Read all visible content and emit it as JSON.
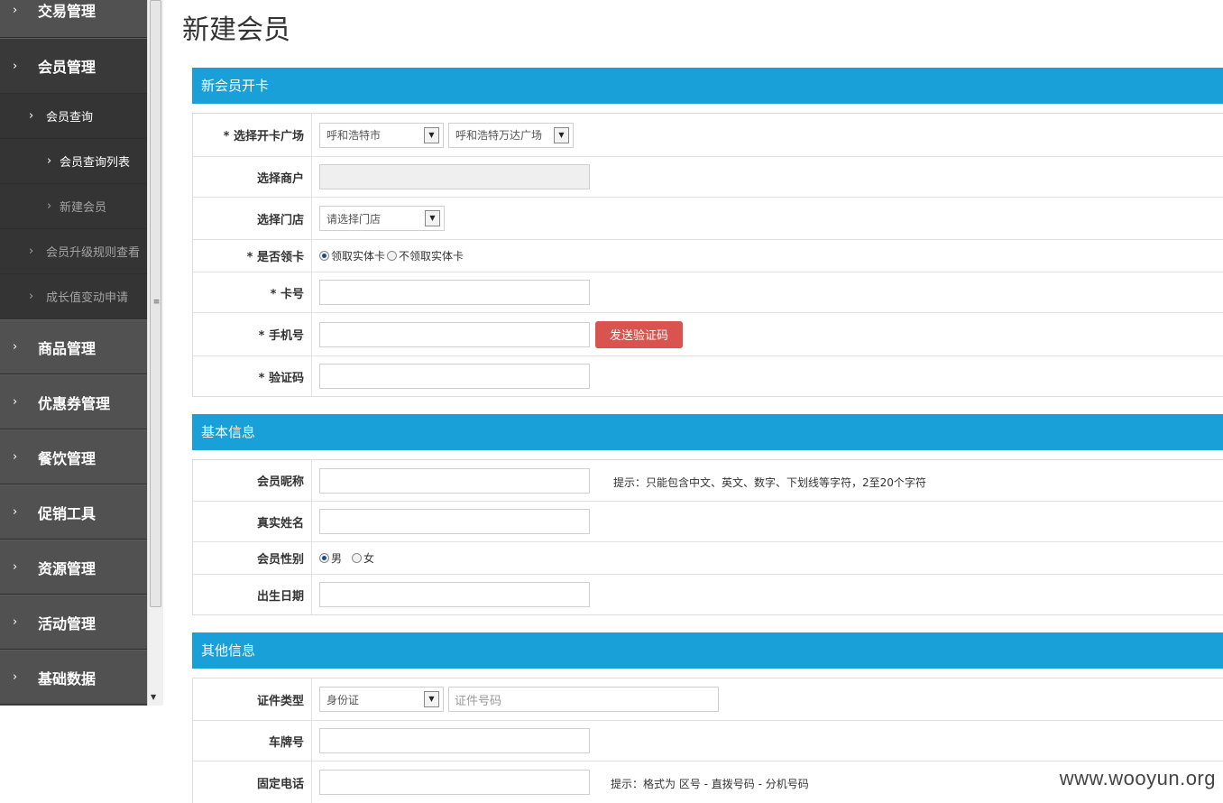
{
  "page_title": "新建会员",
  "sidebar": {
    "items": [
      {
        "label": "交易管理",
        "level": "top"
      },
      {
        "label": "会员管理",
        "level": "top",
        "active": true
      },
      {
        "label": "会员查询",
        "level": "sub"
      },
      {
        "label": "会员查询列表",
        "level": "sub2"
      },
      {
        "label": "新建会员",
        "level": "sub2",
        "dim": true
      },
      {
        "label": "会员升级规则查看",
        "level": "sub",
        "dim": true
      },
      {
        "label": "成长值变动申请",
        "level": "sub",
        "dim": true
      },
      {
        "label": "商品管理",
        "level": "top"
      },
      {
        "label": "优惠券管理",
        "level": "top"
      },
      {
        "label": "餐饮管理",
        "level": "top"
      },
      {
        "label": "促销工具",
        "level": "top"
      },
      {
        "label": "资源管理",
        "level": "top"
      },
      {
        "label": "活动管理",
        "level": "top"
      },
      {
        "label": "基础数据",
        "level": "top"
      }
    ]
  },
  "sections": {
    "card": {
      "title": "新会员开卡",
      "plaza_label": "* 选择开卡广场",
      "city_select": "呼和浩特市",
      "plaza_select": "呼和浩特万达广场",
      "merchant_label": "选择商户",
      "store_label": "选择门店",
      "store_select": "请选择门店",
      "getcard_label": "* 是否领卡",
      "radio_physical": "领取实体卡",
      "radio_no_physical": "不领取实体卡",
      "cardno_label": "* 卡号",
      "phone_label": "* 手机号",
      "send_code_button": "发送验证码",
      "code_label": "* 验证码"
    },
    "basic": {
      "title": "基本信息",
      "nickname_label": "会员昵称",
      "nickname_hint": "提示：只能包含中文、英文、数字、下划线等字符，2至20个字符",
      "realname_label": "真实姓名",
      "gender_label": "会员性别",
      "gender_male": "男",
      "gender_female": "女",
      "birthday_label": "出生日期"
    },
    "other": {
      "title": "其他信息",
      "idtype_label": "证件类型",
      "idtype_select": "身份证",
      "idno_placeholder": "证件号码",
      "plate_label": "车牌号",
      "landline_label": "固定电话",
      "landline_hint": "提示：格式为 区号 - 直拨号码 - 分机号码"
    }
  },
  "watermark": "www.wooyun.org",
  "colors": {
    "section_header": "#19a0d9",
    "button": "#d9534f",
    "sidebar": "#4a4a4a"
  }
}
